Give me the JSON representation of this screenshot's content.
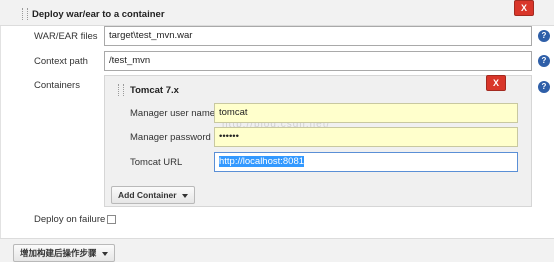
{
  "section": {
    "title": "Deploy war/ear to a container",
    "delete_label": "X"
  },
  "form": {
    "war_label": "WAR/EAR files",
    "war_value": "target\\test_mvn.war",
    "context_label": "Context path",
    "context_value": "/test_mvn",
    "containers_label": "Containers",
    "deploy_failure_label": "Deploy on failure",
    "deploy_failure_checked": false
  },
  "container": {
    "title": "Tomcat 7.x",
    "delete_label": "X",
    "user_label": "Manager user name",
    "user_value": "tomcat",
    "password_label": "Manager password",
    "password_value": "••••••",
    "url_label": "Tomcat URL",
    "url_value": "http://localhost:8081"
  },
  "buttons": {
    "add_container": "Add Container",
    "add_post_build": "增加构建后操作步骤"
  },
  "watermark": "http://blog.csdn.net/",
  "icons": [
    "drag-handle-icon",
    "help-icon",
    "close-icon",
    "caret-down-icon"
  ],
  "colors": {
    "delete_red": "#d9362a",
    "field_yellow": "#ffffcc",
    "selection_blue": "#3399ff",
    "help_blue": "#2f5fa8"
  }
}
